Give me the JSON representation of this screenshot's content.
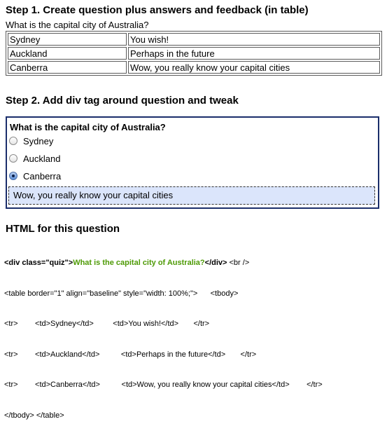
{
  "step1": {
    "heading": "Step 1. Create question plus answers and feedback (in table)",
    "question": "What is the capital city of Australia?",
    "rows": [
      {
        "answer": "Sydney",
        "feedback": "You wish!"
      },
      {
        "answer": "Auckland",
        "feedback": "Perhaps in the future"
      },
      {
        "answer": "Canberra",
        "feedback": "Wow, you really know your capital cities"
      }
    ]
  },
  "step2": {
    "heading": "Step 2. Add div tag around question and tweak",
    "question": "What is the capital city of Australia?",
    "options": [
      {
        "label": "Sydney",
        "selected": false
      },
      {
        "label": "Auckland",
        "selected": false
      },
      {
        "label": "Canberra",
        "selected": true
      }
    ],
    "feedback": "Wow, you really know your capital cities",
    "colors": {
      "border": "#1b2e6b",
      "feedback_bg": "#dbe5fb"
    }
  },
  "html_section": {
    "heading": "HTML for this question",
    "line1": {
      "open_div": "<div class=\"quiz\">",
      "question": "What is the capital city of Australia?",
      "close_div": "</div>",
      "rest": " <br />"
    },
    "line2": "<table border=\"1\" align=\"baseline\" style=\"width: 100%;\">      <tbody>",
    "line3": "<tr>        <td>Sydney</td>         <td>You wish!</td>       </tr>",
    "line4": "<tr>        <td>Auckland</td>          <td>Perhaps in the future</td>       </tr>",
    "line5": "<tr>        <td>Canberra</td>          <td>Wow, you really know your capital cities</td>        </tr>",
    "line6": "</tbody> </table>",
    "colors": {
      "question_text": "#4e9a06"
    }
  }
}
